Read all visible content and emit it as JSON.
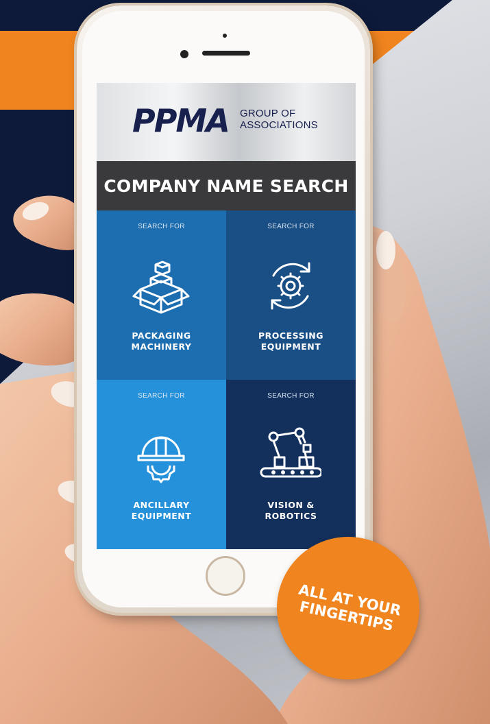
{
  "header": {
    "logo": "PPMA",
    "logo_sub_line1": "GROUP OF",
    "logo_sub_line2": "ASSOCIATIONS"
  },
  "title": "COMPANY NAME SEARCH",
  "tiles": [
    {
      "eyebrow": "SEARCH FOR",
      "line1": "PACKAGING",
      "line2": "MACHINERY",
      "icon": "boxes-icon",
      "color": "#1d6eb1"
    },
    {
      "eyebrow": "SEARCH FOR",
      "line1": "PROCESSING",
      "line2": "EQUIPMENT",
      "icon": "gear-cycle-icon",
      "color": "#1a4f86"
    },
    {
      "eyebrow": "SEARCH FOR",
      "line1": "ANCILLARY",
      "line2": "EQUIPMENT",
      "icon": "hardhat-gear-icon",
      "color": "#2591db"
    },
    {
      "eyebrow": "SEARCH FOR",
      "line1": "VISION &",
      "line2": "ROBOTICS",
      "icon": "robot-arm-icon",
      "color": "#13305c"
    }
  ],
  "badge": {
    "line1": "ALL AT YOUR",
    "line2": "FINGERTIPS",
    "color": "#f0841f"
  },
  "colors": {
    "navy": "#0d1a3a",
    "orange": "#f0841f",
    "title_bar": "#3a3a3c"
  }
}
